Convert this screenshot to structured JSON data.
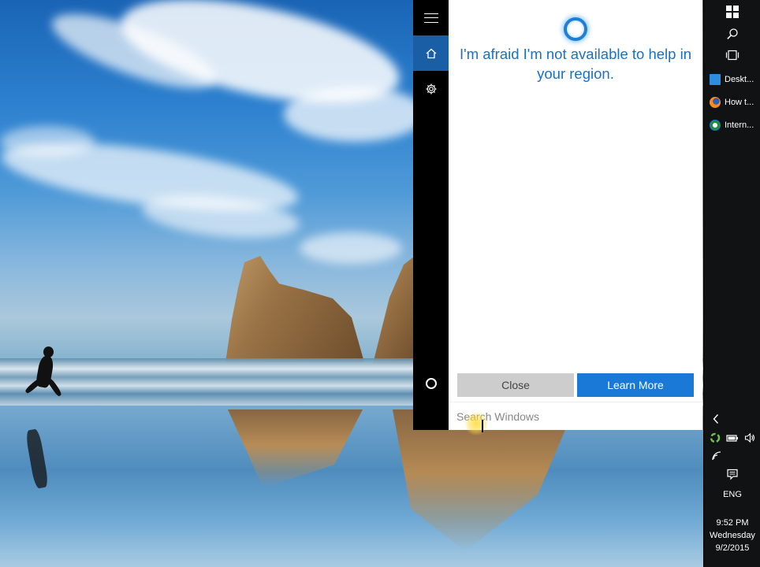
{
  "cortana": {
    "message": "I'm afraid I'm not available to help in your region.",
    "close_label": "Close",
    "learn_more_label": "Learn More",
    "search_placeholder": "Search Windows",
    "accent_color": "#1a78d6",
    "rail_items": [
      {
        "icon": "hamburger-menu-icon"
      },
      {
        "icon": "home-icon",
        "active": true
      },
      {
        "icon": "gear-icon"
      },
      {
        "icon": "cortana-circle-icon"
      }
    ]
  },
  "taskbar": {
    "items": [
      {
        "label": "Deskt...",
        "icon": "desktop-icon"
      },
      {
        "label": "How t...",
        "icon": "firefox-icon"
      },
      {
        "label": "Intern...",
        "icon": "internet-explorer-icon"
      }
    ],
    "language": "ENG",
    "time": "9:52 PM",
    "day": "Wednesday",
    "date": "9/2/2015"
  }
}
